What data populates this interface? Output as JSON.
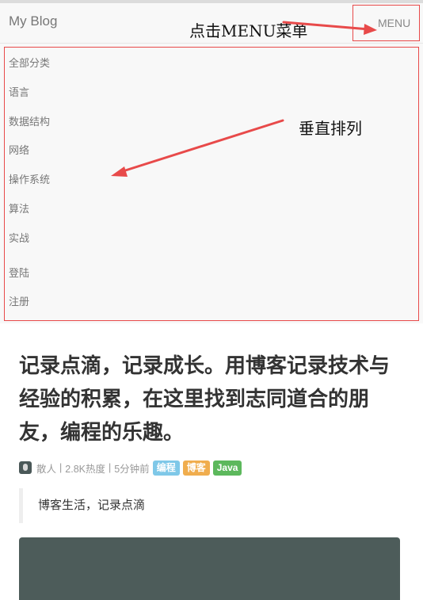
{
  "navbar": {
    "brand": "My Blog",
    "menu_label": "MENU"
  },
  "menu": {
    "items": [
      {
        "label": "全部分类"
      },
      {
        "label": "语言"
      },
      {
        "label": "数据结构"
      },
      {
        "label": "网络"
      },
      {
        "label": "操作系统"
      },
      {
        "label": "算法"
      },
      {
        "label": "实战"
      },
      {
        "label": "登陆"
      },
      {
        "label": "注册"
      }
    ]
  },
  "annotations": {
    "click_menu": "点击MENU菜单",
    "vertical": "垂直排列",
    "color": "#e84a4a"
  },
  "post": {
    "title": "记录点滴，记录成长。用博客记录技术与经验的积累，在这里找到志同道合的朋友，编程的乐趣。",
    "author": "散人",
    "heat": "2.8K热度",
    "time": "5分钟前",
    "separator": "|",
    "tags": [
      {
        "label": "编程",
        "color": "#7fc8e8"
      },
      {
        "label": "博客",
        "color": "#f0ad4e"
      },
      {
        "label": "Java",
        "color": "#5cb85c"
      }
    ],
    "quote": "博客生活，记录点滴"
  }
}
